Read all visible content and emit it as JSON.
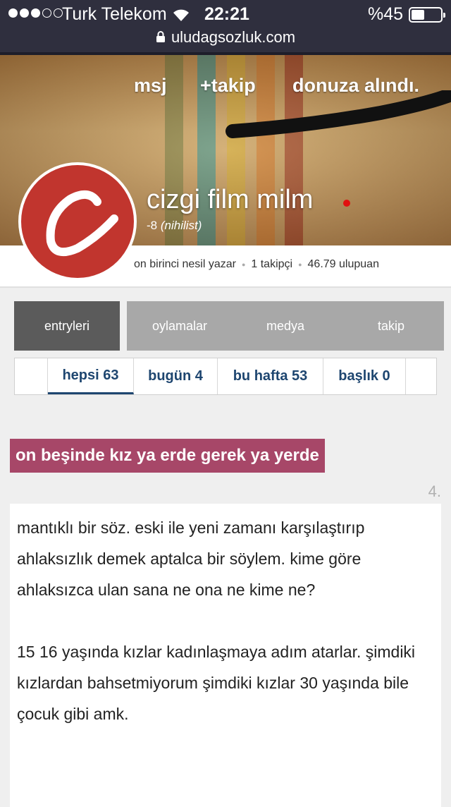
{
  "status_bar": {
    "carrier": "Turk Telekom",
    "time": "22:21",
    "battery": "%45",
    "battery_level": 0.45
  },
  "url_bar": {
    "url": "uludagsozluk.com"
  },
  "profile": {
    "nav": [
      "msj",
      "+takip",
      "donuza alındı."
    ],
    "username": "cizgi film milm",
    "karma_score": "-8",
    "karma_title": "(nihilist)",
    "stats": [
      "on birinci nesil yazar",
      "1 takipçi",
      "46.79 ulupuan"
    ],
    "online_color": "#e01010",
    "avatar_letter_icon": "cursive-c-icon"
  },
  "tabs": [
    {
      "label": "entryleri",
      "active": true
    },
    {
      "label": "oylamalar",
      "active": false
    },
    {
      "label": "medya",
      "active": false
    },
    {
      "label": "takip",
      "active": false
    }
  ],
  "filters": [
    {
      "label": "hepsi 63",
      "active": true
    },
    {
      "label": "bugün 4",
      "active": false
    },
    {
      "label": "bu hafta 53",
      "active": false
    },
    {
      "label": "başlık 0",
      "active": false
    }
  ],
  "entry": {
    "topic_title": "on beşinde kız ya erde gerek ya yerde",
    "number": "4.",
    "paragraphs": [
      "mantıklı bir söz. eski ile yeni zamanı karşılaştırıp ahlaksızlık demek aptalca bir söylem. kime göre ahlaksızca ulan sana ne ona ne kime ne?",
      "15 16 yaşında kızlar kadınlaşmaya adım atarlar. şimdiki kızlardan bahsetmiyorum şimdiki kızlar 30 yaşında bile çocuk gibi amk."
    ]
  },
  "colors": {
    "topic_bg": "#a74768",
    "filter_text": "#1e4670",
    "tab_active": "#5b5b5b",
    "tab_inactive": "#a8a8a8",
    "avatar_bg": "#c1352e"
  }
}
